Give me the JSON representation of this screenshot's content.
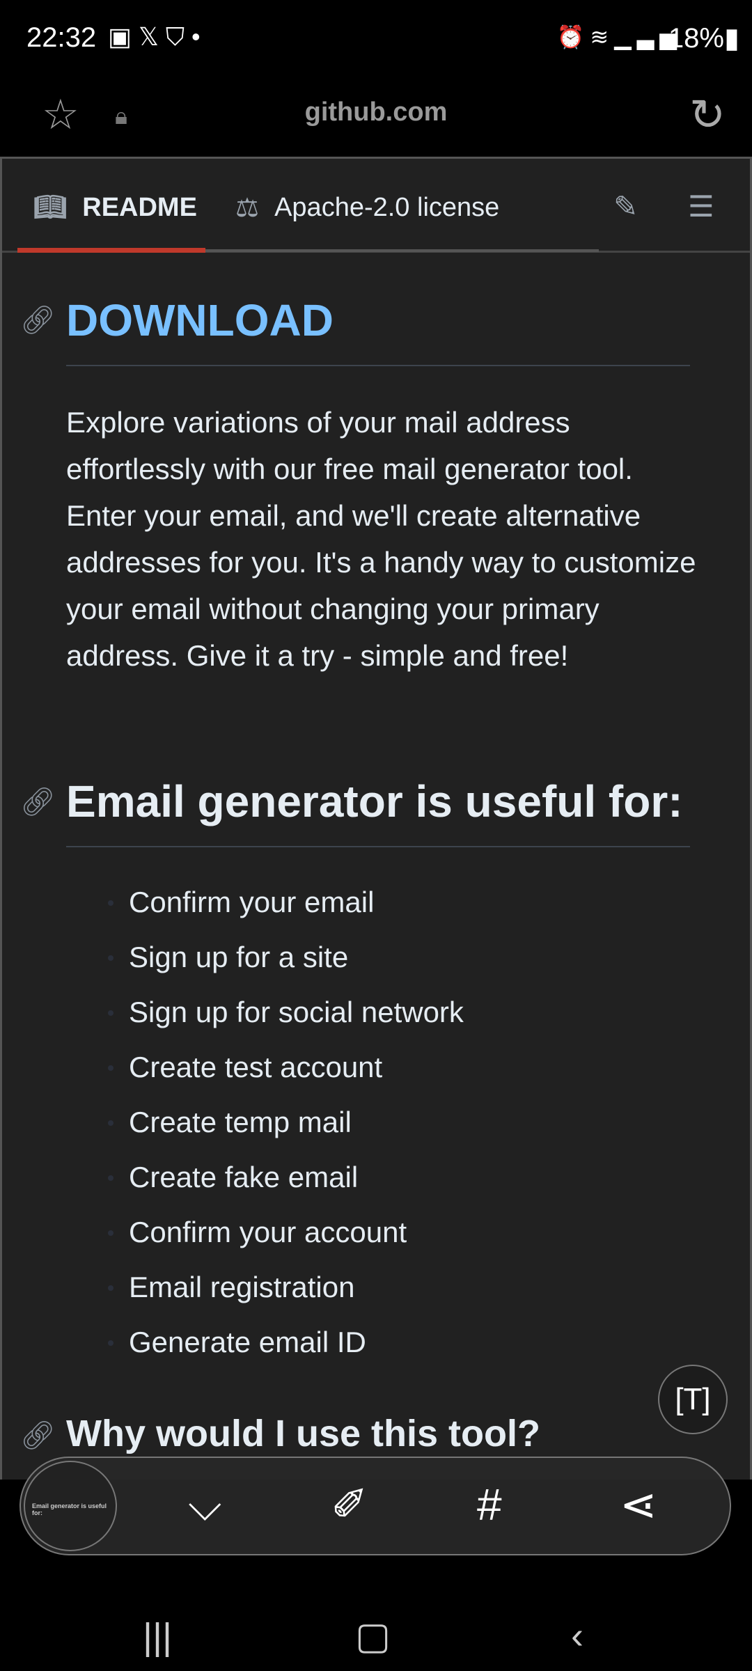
{
  "status": {
    "time": "22:32",
    "battery": "18%",
    "left_icons": [
      "gallery-icon",
      "x-icon",
      "shield-icon",
      "dot"
    ],
    "right_icons": [
      "alarm-icon",
      "wifi-icon",
      "signal-icon",
      "signal-icon"
    ]
  },
  "browser": {
    "url": "github.com"
  },
  "tabs": [
    {
      "label": "README",
      "active": true
    },
    {
      "label": "Apache-2.0 license"
    }
  ],
  "accent": "#c0392b",
  "content": {
    "h1": "DOWNLOAD",
    "h1_color": "#79c0ff",
    "paragraph": "Explore variations of your mail address effortlessly with our free mail generator tool. Enter your email, and we'll create alternative addresses for you. It's a handy way to customize your email without changing your primary address. Give it a try - simple and free!",
    "h2": "Email generator is useful for:",
    "items": [
      "Confirm your email",
      "Sign up for a site",
      "Sign up for social network",
      "Create test account",
      "Create temp mail",
      "Create fake email",
      "Confirm your account",
      "Email registration",
      "Generate email ID"
    ],
    "h2b": "Why would I use this tool?"
  },
  "screenshot_toolbar": {
    "thumb_heading": "Email generator is useful for:",
    "hash": "#"
  }
}
